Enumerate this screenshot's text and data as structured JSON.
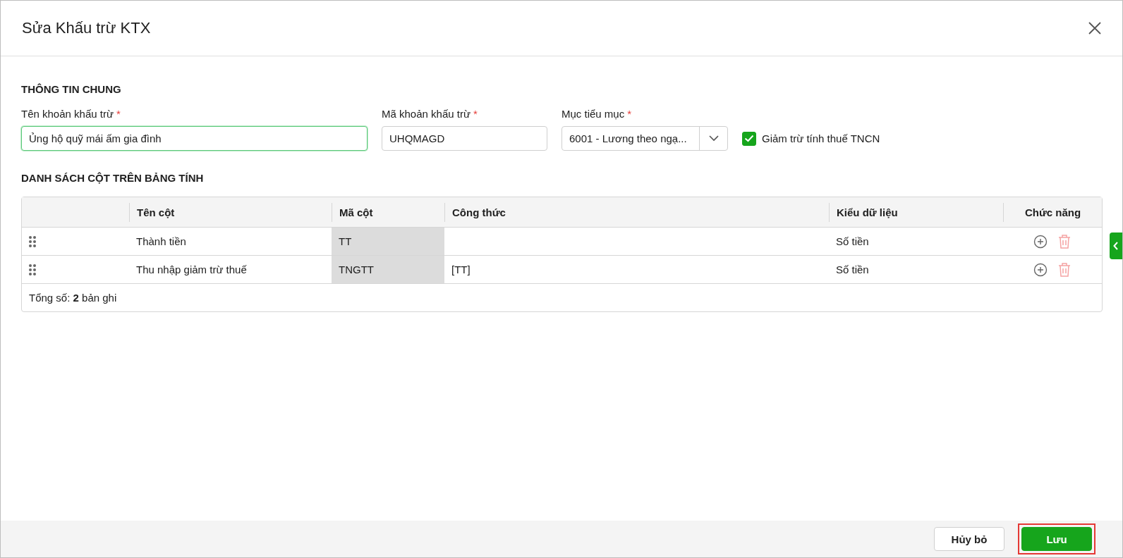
{
  "window": {
    "title": "Sửa Khấu trừ KTX"
  },
  "general": {
    "heading": "THÔNG TIN CHUNG",
    "fields": [
      {
        "kind": "text",
        "label": "Tên khoản khấu trừ",
        "required": "*",
        "value": "Ủng hộ quỹ mái ấm gia đình",
        "focused": true
      },
      {
        "kind": "text",
        "label": "Mã khoản khấu trừ",
        "required": "*",
        "value": "UHQMAGD",
        "focused": false
      },
      {
        "kind": "select",
        "label": "Mục tiểu mục",
        "required": "*",
        "value": "6001 - Lương theo ngạ...",
        "focused": false
      }
    ],
    "checkbox": {
      "label": "Giảm trừ tính thuế TNCN",
      "checked": true
    }
  },
  "columns_section": {
    "heading": "DANH SÁCH CỘT TRÊN BẢNG TÍNH",
    "table": {
      "columns": [
        "Tên cột",
        "Mã cột",
        "Công thức",
        "Kiểu dữ liệu",
        "Chức năng"
      ],
      "rows": [
        {
          "name": "Thành tiền",
          "code": "TT",
          "type": "Số tiền"
        },
        {
          "name": "Thu nhập giảm trừ thuế",
          "code": "TNGTT",
          "formula": "[TT]",
          "type": "Số tiền"
        }
      ],
      "total": "Tổng số: **2** bản ghi"
    }
  },
  "footer": {
    "buttons": [
      {
        "label": "Hủy bỏ",
        "kind": "secondary",
        "highlighted": false
      },
      {
        "label": "Lưu",
        "kind": "primary",
        "highlighted": true
      }
    ]
  }
}
